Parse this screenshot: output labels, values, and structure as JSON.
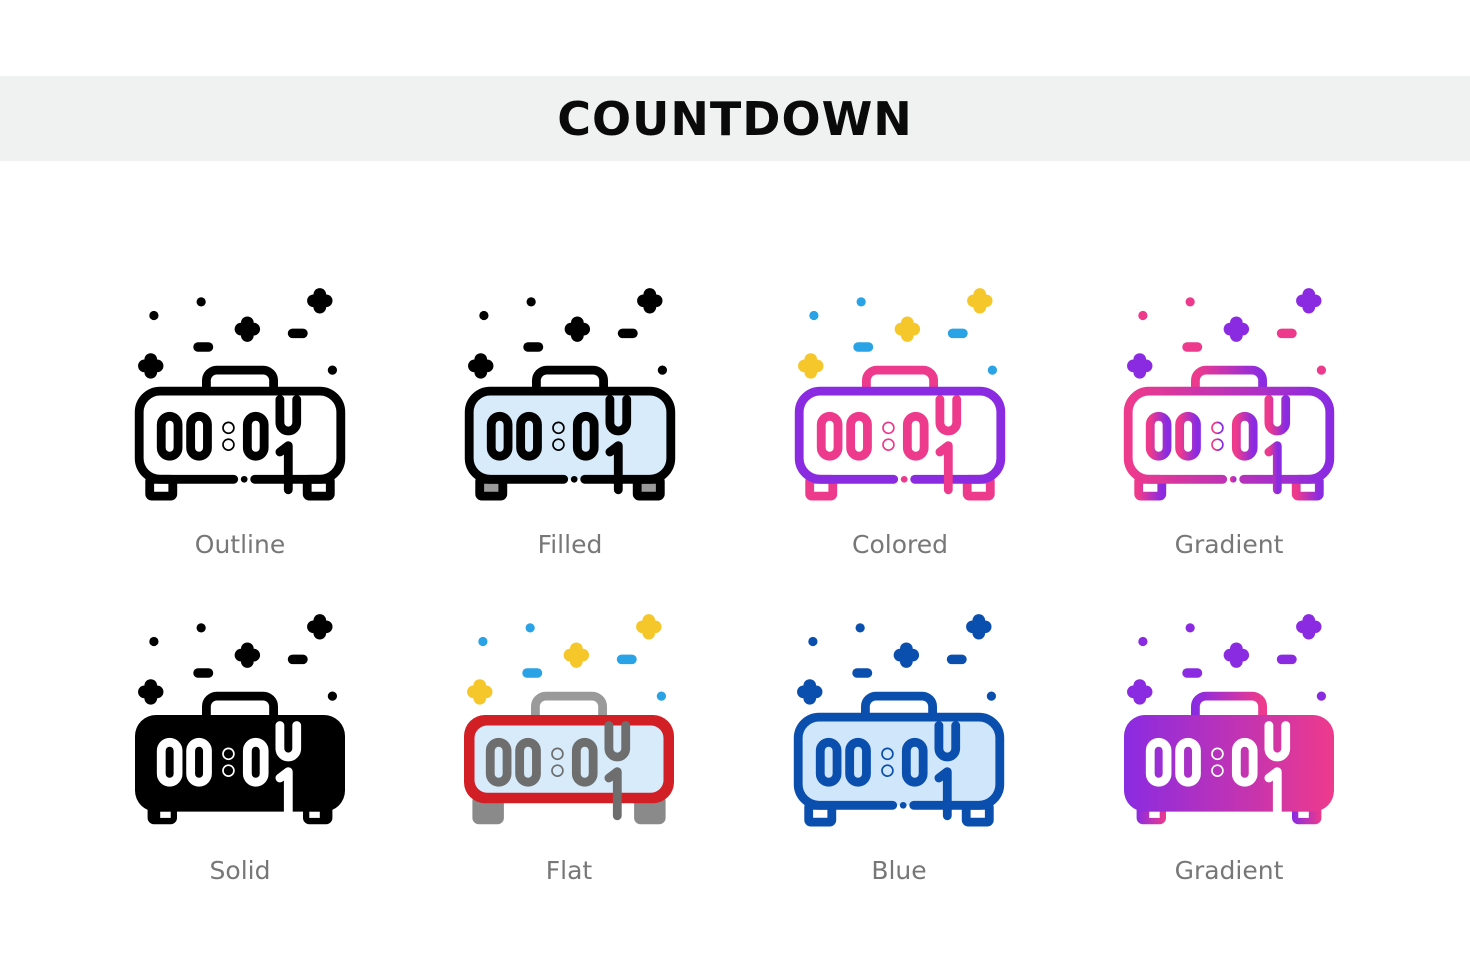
{
  "header": {
    "title": "COUNTDOWN"
  },
  "icon": {
    "subject": "alarm-clock-countdown",
    "digits": [
      "0",
      "0",
      ":",
      "0",
      "1"
    ]
  },
  "variants": [
    {
      "id": "outline",
      "label": "Outline",
      "style": "outline",
      "colors": {
        "stroke": "#000000",
        "screen": "none",
        "feet": "none",
        "confetti_a": "#000000",
        "confetti_b": "#000000",
        "digits": "#000000"
      }
    },
    {
      "id": "filled",
      "label": "Filled",
      "style": "filled",
      "colors": {
        "stroke": "#000000",
        "screen": "#d7ebfb",
        "feet": "#9a9a9a",
        "confetti_a": "#000000",
        "confetti_b": "#000000",
        "digits": "#000000"
      }
    },
    {
      "id": "colored",
      "label": "Colored",
      "style": "colored",
      "colors": {
        "body": "#8a2be2",
        "accent": "#ee3a8c",
        "confetti_a": "#29a3e6",
        "confetti_b": "#f5c72b"
      }
    },
    {
      "id": "gradient-1",
      "label": "Gradient",
      "style": "gradient-outline",
      "colors": {
        "from": "#ee3a8c",
        "to": "#8a2be2"
      }
    },
    {
      "id": "solid",
      "label": "Solid",
      "style": "solid",
      "colors": {
        "fill": "#000000",
        "digits": "#ffffff"
      }
    },
    {
      "id": "flat",
      "label": "Flat",
      "style": "flat",
      "colors": {
        "frame": "#d21f26",
        "screen": "#d7ebfb",
        "handle": "#9a9a9a",
        "feet": "#8a8a8a",
        "digits": "#6e6e6e",
        "confetti_a": "#29a3e6",
        "confetti_b": "#f5c72b"
      }
    },
    {
      "id": "blue",
      "label": "Blue",
      "style": "blue",
      "colors": {
        "stroke": "#0b4fae",
        "screen": "#cfe6fb"
      }
    },
    {
      "id": "gradient-2",
      "label": "Gradient",
      "style": "gradient-solid",
      "colors": {
        "from": "#8a2be2",
        "to": "#ee3a8c"
      }
    }
  ]
}
